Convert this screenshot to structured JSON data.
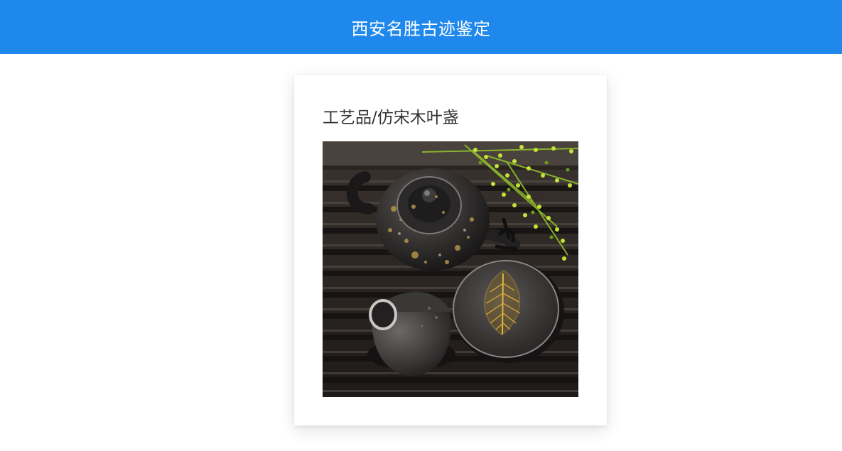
{
  "header": {
    "title": "西安名胜古迹鉴定",
    "background_color": "#1f88ec"
  },
  "card": {
    "title": "工艺品/仿宋木叶盏",
    "image": {
      "subject": "tea-set-photo"
    }
  }
}
